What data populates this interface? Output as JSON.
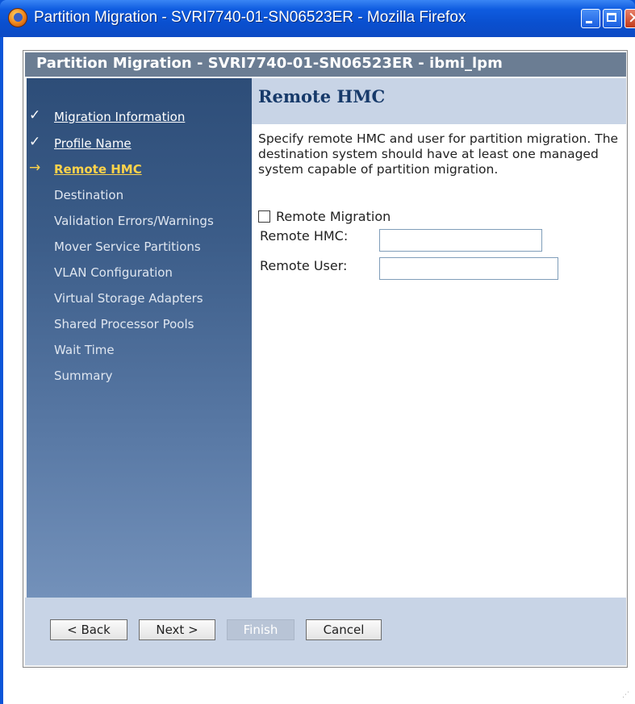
{
  "window": {
    "title": "Partition Migration - SVRI7740-01-SN06523ER - Mozilla Firefox",
    "icon": "firefox-icon",
    "controls": [
      "minimize-icon",
      "maximize-icon",
      "close-icon"
    ]
  },
  "wizard": {
    "header": "Partition Migration - SVRI7740-01-SN06523ER - ibmi_lpm",
    "nav": [
      {
        "label": "Migration Information",
        "state": "done",
        "mark": "✓"
      },
      {
        "label": "Profile Name",
        "state": "done",
        "mark": "✓"
      },
      {
        "label": "Remote HMC",
        "state": "current",
        "mark": "→"
      },
      {
        "label": "Destination",
        "state": "todo",
        "mark": ""
      },
      {
        "label": "Validation Errors/Warnings",
        "state": "todo",
        "mark": ""
      },
      {
        "label": "Mover Service Partitions",
        "state": "todo",
        "mark": ""
      },
      {
        "label": "VLAN Configuration",
        "state": "todo",
        "mark": ""
      },
      {
        "label": "Virtual Storage Adapters",
        "state": "todo",
        "mark": ""
      },
      {
        "label": "Shared Processor Pools",
        "state": "todo",
        "mark": ""
      },
      {
        "label": "Wait Time",
        "state": "todo",
        "mark": ""
      },
      {
        "label": "Summary",
        "state": "todo",
        "mark": ""
      }
    ],
    "page_title": "Remote HMC",
    "description": "Specify remote HMC and user for partition migration. The destination system should have at least one managed system capable of partition migration.",
    "remote_migration_label": "Remote Migration",
    "remote_migration_checked": false,
    "remote_hmc_label": "Remote HMC:",
    "remote_hmc_value": "",
    "remote_user_label": "Remote User:",
    "remote_user_value": "",
    "buttons": {
      "back": "< Back",
      "next": "Next >",
      "finish": "Finish",
      "cancel": "Cancel"
    }
  }
}
